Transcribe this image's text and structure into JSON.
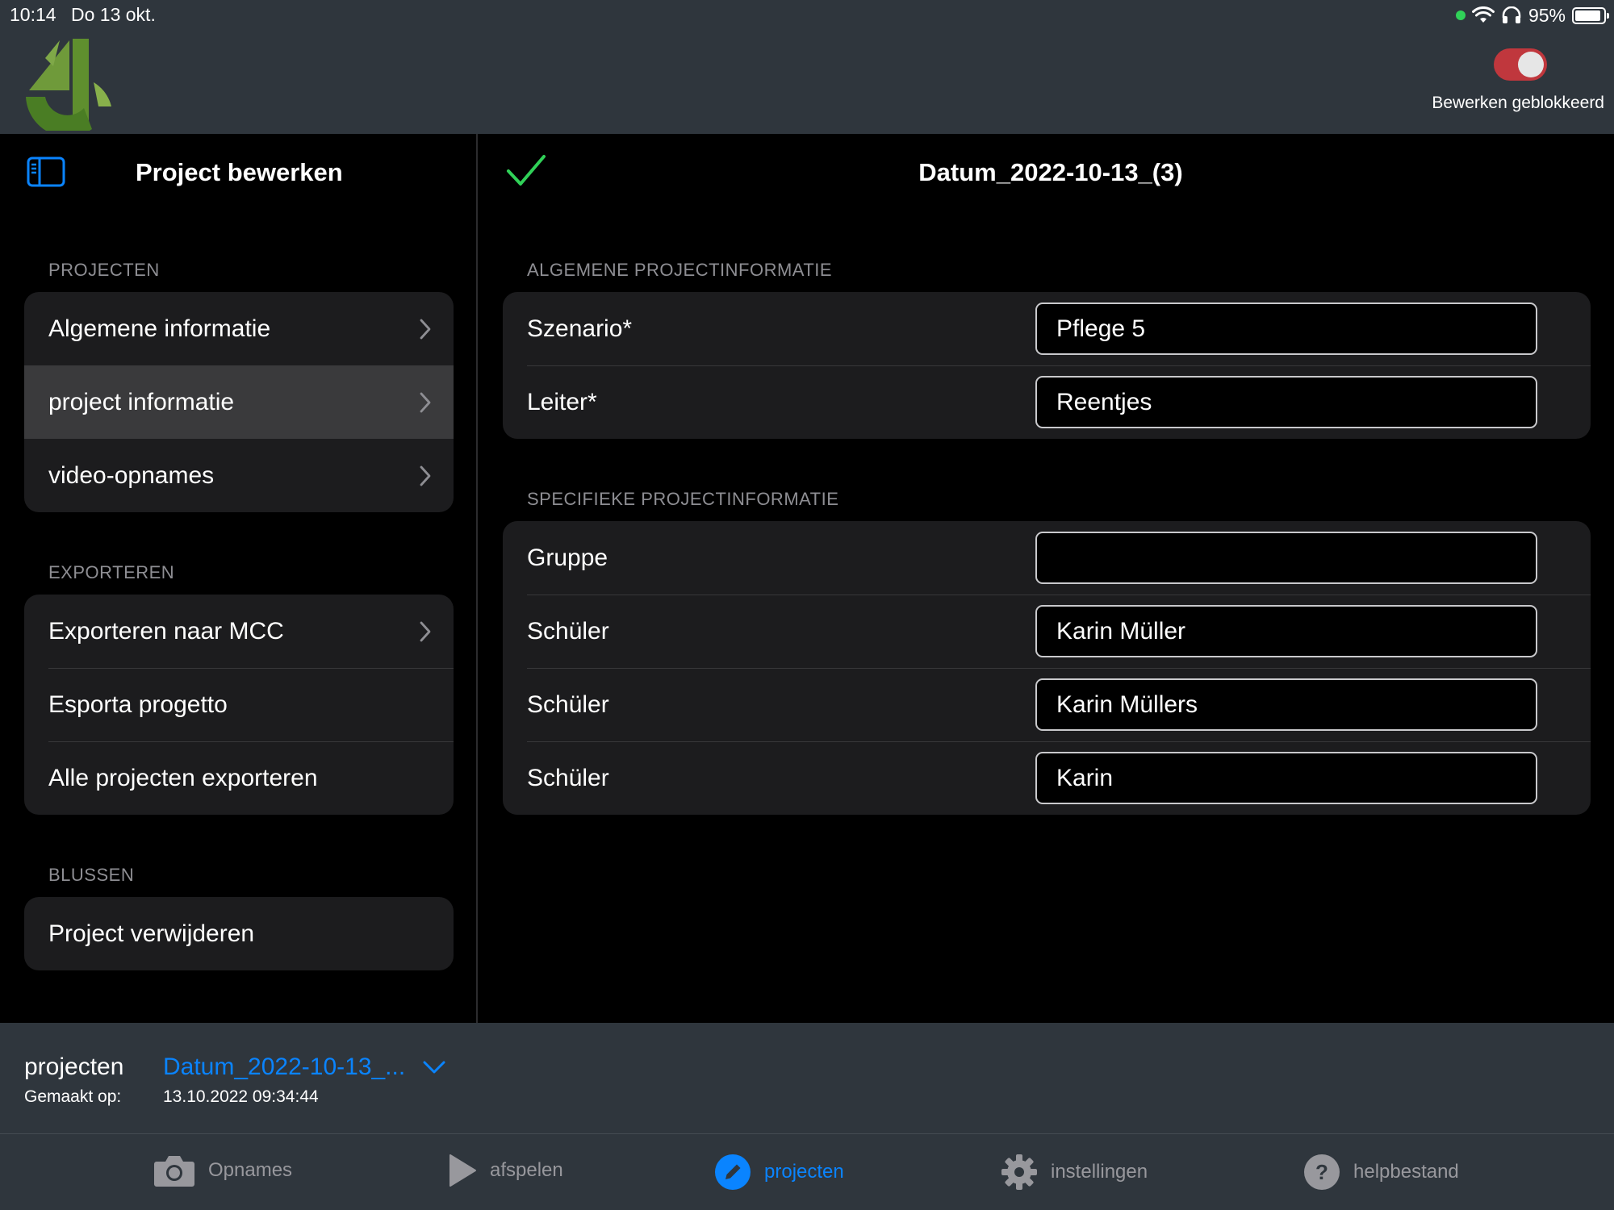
{
  "status_bar": {
    "time": "10:14",
    "date": "Do 13 okt.",
    "battery": "95%"
  },
  "header": {
    "toggle_label": "Bewerken geblokkeerd",
    "toggle_on": true,
    "accent_color": "#c0373d"
  },
  "sidebar": {
    "title": "Project bewerken",
    "sections": [
      {
        "label": "PROJECTEN",
        "items": [
          {
            "label": "Algemene informatie"
          },
          {
            "label": "project informatie"
          },
          {
            "label": "video-opnames"
          }
        ]
      },
      {
        "label": "EXPORTEREN",
        "items": [
          {
            "label": "Exporteren naar MCC"
          },
          {
            "label": "Esporta progetto"
          },
          {
            "label": "Alle projecten exporteren"
          }
        ]
      },
      {
        "label": "BLUSSEN",
        "items": [
          {
            "label": "Project verwijderen"
          }
        ]
      }
    ]
  },
  "detail": {
    "title": "Datum_2022-10-13_(3)",
    "general": {
      "label": "ALGEMENE PROJECTINFORMATIE",
      "fields": [
        {
          "label": "Szenario*",
          "value": "Pflege 5"
        },
        {
          "label": "Leiter*",
          "value": "Reentjes"
        }
      ]
    },
    "specific": {
      "label": "SPECIFIEKE PROJECTINFORMATIE",
      "fields": [
        {
          "label": "Gruppe",
          "value": ""
        },
        {
          "label": "Schüler",
          "value": "Karin Müller"
        },
        {
          "label": "Schüler",
          "value": "Karin Müllers"
        },
        {
          "label": "Schüler",
          "value": "Karin"
        }
      ]
    }
  },
  "project_bar": {
    "label": "projecten",
    "selected": "Datum_2022-10-13_...",
    "created_label": "Gemaakt op:",
    "created_value": "13.10.2022 09:34:44"
  },
  "tabs": [
    {
      "label": "Opnames",
      "icon": "camera-icon"
    },
    {
      "label": "afspelen",
      "icon": "play-icon"
    },
    {
      "label": "projecten",
      "icon": "edit-icon",
      "active": true
    },
    {
      "label": "instellingen",
      "icon": "gear-icon"
    },
    {
      "label": "helpbestand",
      "icon": "help-icon"
    }
  ],
  "colors": {
    "link_blue": "#0a84ff",
    "check_green": "#30d158",
    "panel": "#1c1c1e",
    "chrome": "#2f363d"
  }
}
